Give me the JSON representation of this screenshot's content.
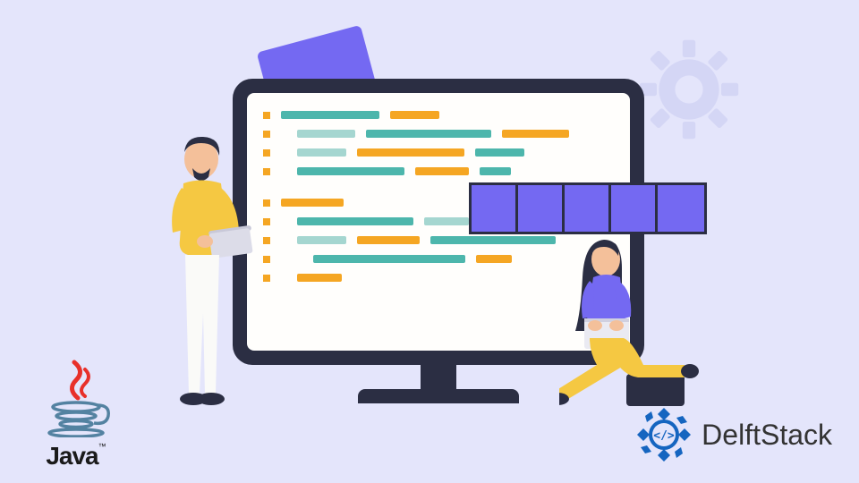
{
  "logos": {
    "java": {
      "text": "Java",
      "tm": "™"
    },
    "delftstack": {
      "text": "DelftStack"
    }
  },
  "array": {
    "cell_count": 5
  },
  "colors": {
    "background": "#e4e5fb",
    "accent_purple": "#7469f2",
    "monitor_frame": "#2b2e43",
    "code_teal": "#4db6ac",
    "code_orange": "#f5a623",
    "code_light_teal": "#a5d6d0",
    "java_red": "#e8302a",
    "java_blue": "#5382a1",
    "delft_blue": "#1565c0"
  }
}
